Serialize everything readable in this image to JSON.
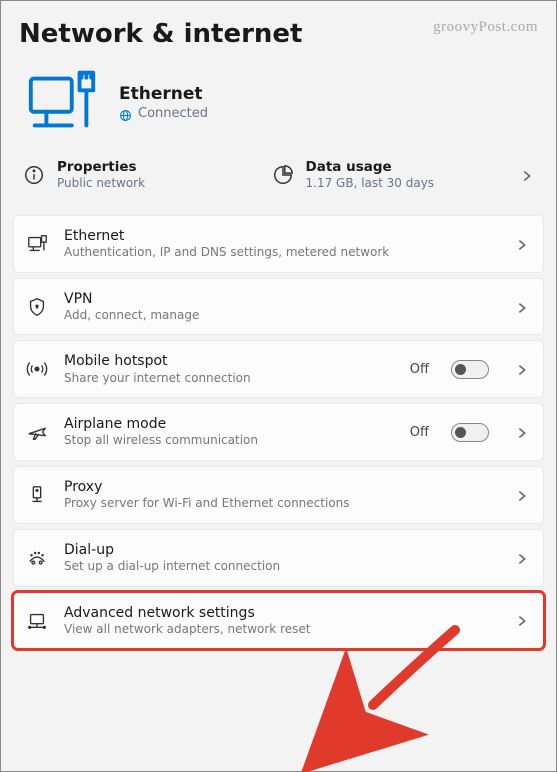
{
  "header": {
    "title": "Network & internet",
    "watermark": "groovyPost.com"
  },
  "connection": {
    "name": "Ethernet",
    "status": "Connected"
  },
  "summary": {
    "properties": {
      "title": "Properties",
      "sub": "Public network"
    },
    "data_usage": {
      "title": "Data usage",
      "sub": "1.17 GB, last 30 days"
    }
  },
  "items": [
    {
      "title": "Ethernet",
      "sub": "Authentication, IP and DNS settings, metered network",
      "icon": "ethernet-icon"
    },
    {
      "title": "VPN",
      "sub": "Add, connect, manage",
      "icon": "shield-icon"
    },
    {
      "title": "Mobile hotspot",
      "sub": "Share your internet connection",
      "icon": "hotspot-icon",
      "toggle": "Off"
    },
    {
      "title": "Airplane mode",
      "sub": "Stop all wireless communication",
      "icon": "airplane-icon",
      "toggle": "Off"
    },
    {
      "title": "Proxy",
      "sub": "Proxy server for Wi-Fi and Ethernet connections",
      "icon": "proxy-icon"
    },
    {
      "title": "Dial-up",
      "sub": "Set up a dial-up internet connection",
      "icon": "dialup-icon"
    },
    {
      "title": "Advanced network settings",
      "sub": "View all network adapters, network reset",
      "icon": "network-adapter-icon",
      "highlight": true
    }
  ]
}
